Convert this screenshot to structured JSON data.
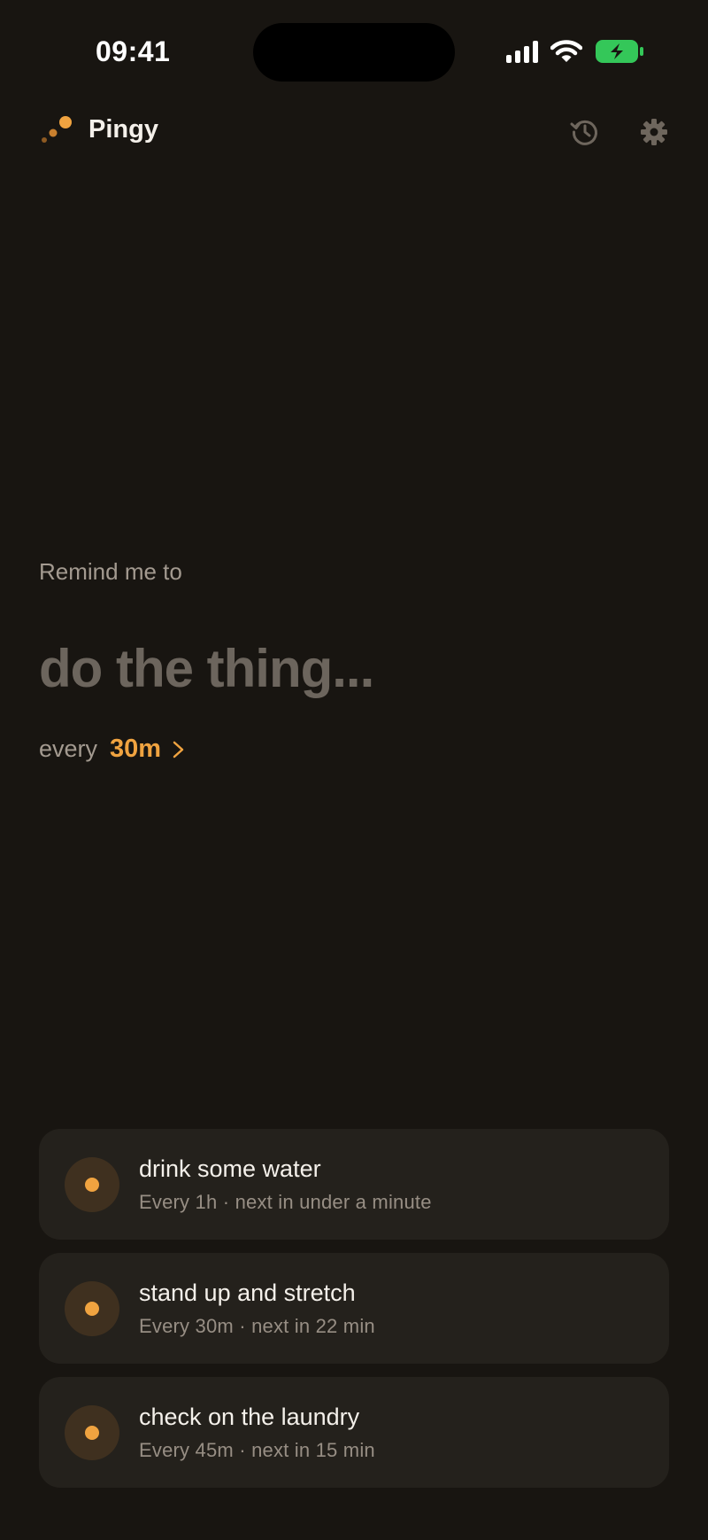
{
  "status_bar": {
    "time": "09:41",
    "battery_color": "#34c759"
  },
  "header": {
    "app_name": "Pingy",
    "accent_color": "#f0a340",
    "history_icon": "history-icon",
    "settings_icon": "gear-icon"
  },
  "composer": {
    "prompt_label": "Remind me to",
    "input_placeholder": "do the thing...",
    "input_value": "",
    "interval_prefix": "every",
    "interval_value": "30m"
  },
  "reminders": [
    {
      "title": "drink some water",
      "meta": "Every 1h · next in under a minute"
    },
    {
      "title": "stand up and stretch",
      "meta": "Every 30m · next in 22 min"
    },
    {
      "title": "check on the laundry",
      "meta": "Every 45m · next in 15 min"
    }
  ]
}
